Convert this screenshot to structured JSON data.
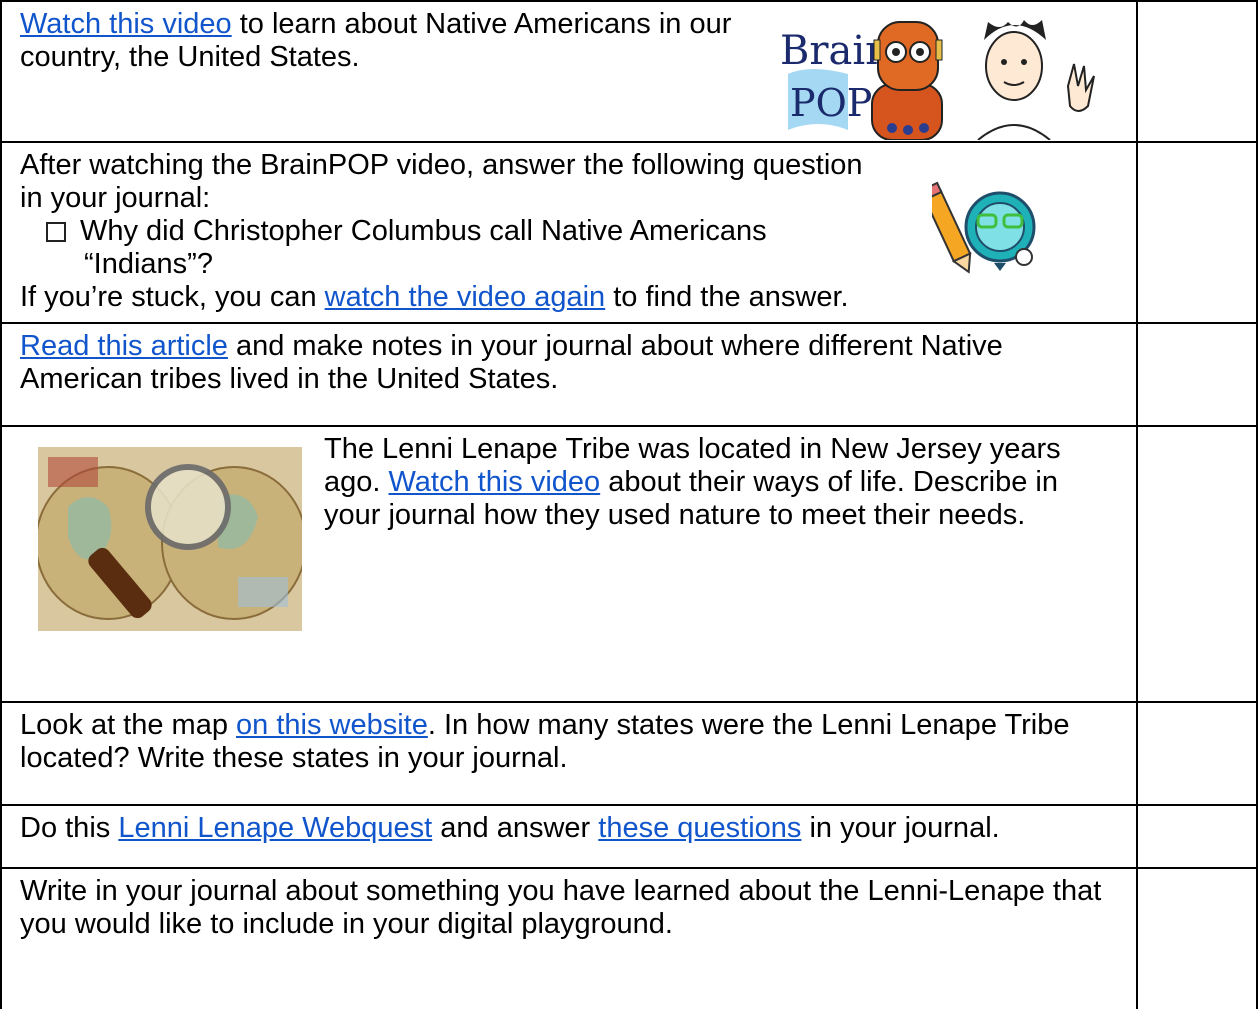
{
  "rows": [
    {
      "link": "Watch this video",
      "text": " to learn about Native Americans in our country, the United States.",
      "logo_text": [
        "Brain",
        "POP"
      ]
    },
    {
      "line1": "After watching the BrainPOP video, answer the following question in your journal:",
      "bullet": "Why did Christopher Columbus call Native Americans “Indians”?",
      "tail_pre": "If you’re stuck, you can ",
      "tail_link": "watch the video again",
      "tail_post": " to find the answer."
    },
    {
      "link": "Read this article",
      "text": " and make notes in your journal about where different Native American tribes lived in the United States."
    },
    {
      "pre": "The Lenni Lenape Tribe was located in New Jersey years ago. ",
      "link": "Watch this video",
      "post": " about their ways of life. Describe in your journal how they used nature to meet their needs."
    },
    {
      "pre": "Look at the map ",
      "link": "on this website",
      "post": ". In how many states were the Lenni Lenape Tribe located?  Write these states in your journal."
    },
    {
      "pre": "Do this ",
      "link1": "Lenni Lenape Webquest",
      "mid": " and answer ",
      "link2": "these questions",
      "post": " in your journal."
    },
    {
      "text": "Write in your journal about something you have learned about the Lenni-Lenape that you would like to include in your digital playground."
    }
  ]
}
